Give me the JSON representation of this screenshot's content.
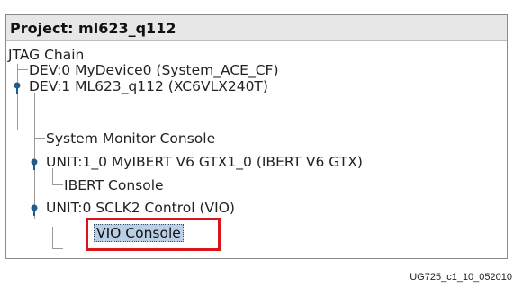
{
  "panel": {
    "title": "Project: ml623_q112"
  },
  "tree": {
    "root": "JTAG Chain",
    "dev0": "DEV:0 MyDevice0 (System_ACE_CF)",
    "dev1": "DEV:1 ML623_q112 (XC6VLX240T)",
    "sysmon": "System Monitor Console",
    "unit1": "UNIT:1_0 MyIBERT V6 GTX1_0 (IBERT V6 GTX)",
    "ibert_console": "IBERT Console",
    "unit0": "UNIT:0 SCLK2 Control (VIO)",
    "vio_console": "VIO Console"
  },
  "caption": "UG725_c1_10_052010",
  "colors": {
    "selection_highlight": "#b9cfe6",
    "callout_box": "#d9141b",
    "expander_icon": "#1e5c8a"
  }
}
